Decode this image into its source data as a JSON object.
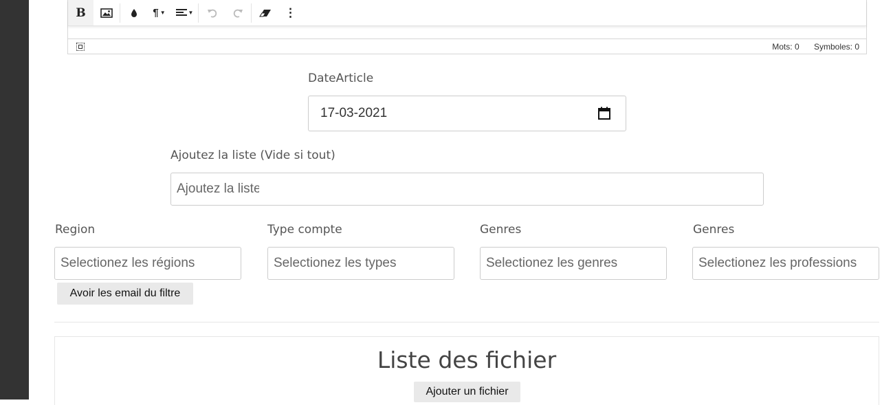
{
  "editor": {
    "toolbar": [
      {
        "icon": "bold-icon",
        "glyph": "B"
      },
      {
        "icon": "image-icon"
      },
      {
        "icon": "color-drop-icon"
      },
      {
        "icon": "paragraph-icon",
        "glyph": "¶"
      },
      {
        "icon": "align-icon"
      },
      {
        "icon": "undo-icon"
      },
      {
        "icon": "redo-icon"
      },
      {
        "icon": "eraser-icon"
      },
      {
        "icon": "more-icon",
        "glyph": "⋮"
      }
    ],
    "status": {
      "words": "Mots: 0",
      "symbols": "Symboles: 0"
    }
  },
  "date_field": {
    "label": "DateArticle",
    "value": "17-03-2021"
  },
  "list_field": {
    "label": "Ajoutez la liste (Vide si tout)",
    "placeholder": "Ajoutez la liste"
  },
  "filters": [
    {
      "label": "Region",
      "placeholder": "Selectionez les régions"
    },
    {
      "label": "Type compte",
      "placeholder": "Selectionez les types"
    },
    {
      "label": "Genres",
      "placeholder": "Selectionez les genres"
    },
    {
      "label": "Genres",
      "placeholder": "Selectionez les professions"
    }
  ],
  "email_button": "Avoir les email du filtre",
  "files": {
    "title": "Liste des fichier",
    "add_button": "Ajouter un fichier"
  }
}
